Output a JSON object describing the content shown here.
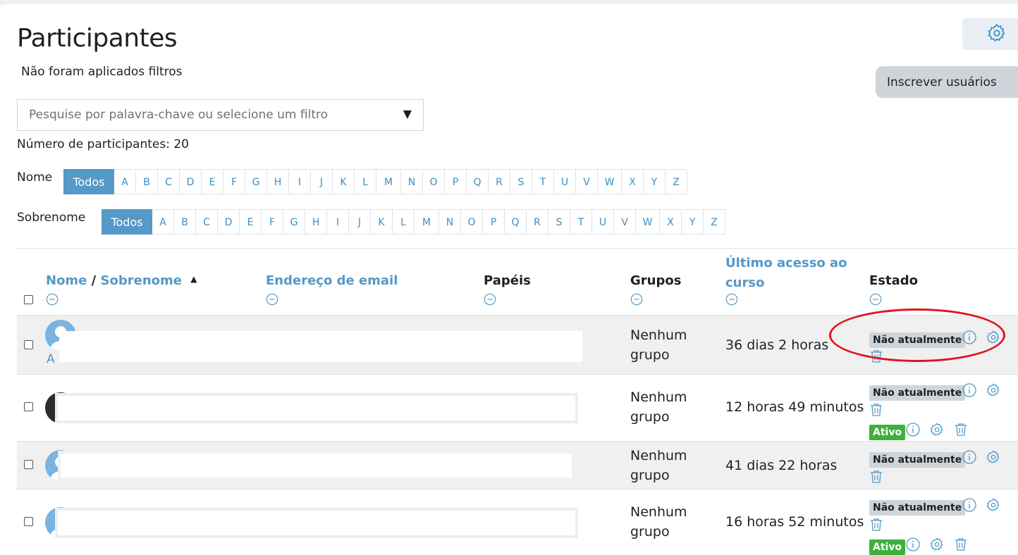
{
  "page": {
    "title": "Participantes",
    "filters_status": "Não foram aplicados filtros",
    "enroll_button": "Inscrever usuários",
    "search_placeholder": "Pesquise por palavra-chave ou selecione um filtro",
    "search_caret": "▼",
    "participant_count": "Número de participantes: 20"
  },
  "first_name_bar": {
    "label": "Nome",
    "all": "Todos",
    "letters": [
      "A",
      "B",
      "C",
      "D",
      "E",
      "F",
      "G",
      "H",
      "I",
      "J",
      "K",
      "L",
      "M",
      "N",
      "O",
      "P",
      "Q",
      "R",
      "S",
      "T",
      "U",
      "V",
      "W",
      "X",
      "Y",
      "Z"
    ]
  },
  "last_name_bar": {
    "label": "Sobrenome",
    "all": "Todos",
    "letters": [
      "A",
      "B",
      "C",
      "D",
      "E",
      "F",
      "G",
      "H",
      "I",
      "J",
      "K",
      "L",
      "M",
      "N",
      "O",
      "P",
      "Q",
      "R",
      "S",
      "T",
      "U",
      "V",
      "W",
      "X",
      "Y",
      "Z"
    ]
  },
  "table": {
    "headers": {
      "name": "Nome",
      "separator": " / ",
      "surname": "Sobrenome",
      "sort_indicator": "▲",
      "email": "Endereço de email",
      "roles": "Papéis",
      "groups": "Grupos",
      "last_access_line1": "Último acesso ao",
      "last_access_line2": "curso",
      "status": "Estado"
    },
    "rows": [
      {
        "initial": "A",
        "groups_line1": "Nenhum",
        "groups_line2": "grupo",
        "last_access": "36 dias 2 horas",
        "status": "Não atualmente"
      },
      {
        "groups_line1": "Nenhum",
        "groups_line2": "grupo",
        "last_access": "12 horas 49 minutos",
        "status": "Não atualmente",
        "status2": "Ativo"
      },
      {
        "groups_line1": "Nenhum",
        "groups_line2": "grupo",
        "last_access": "41 dias 22 horas",
        "status": "Não atualmente"
      },
      {
        "groups_line1": "Nenhum",
        "groups_line2": "grupo",
        "last_access": "16 horas 52 minutos",
        "status": "Não atualmente",
        "status2": "Ativo"
      }
    ]
  },
  "colors": {
    "accent": "#5499c7",
    "active_badge": "#3fb03d",
    "inactive_badge": "#ced4da",
    "annotation": "#e0141e"
  }
}
